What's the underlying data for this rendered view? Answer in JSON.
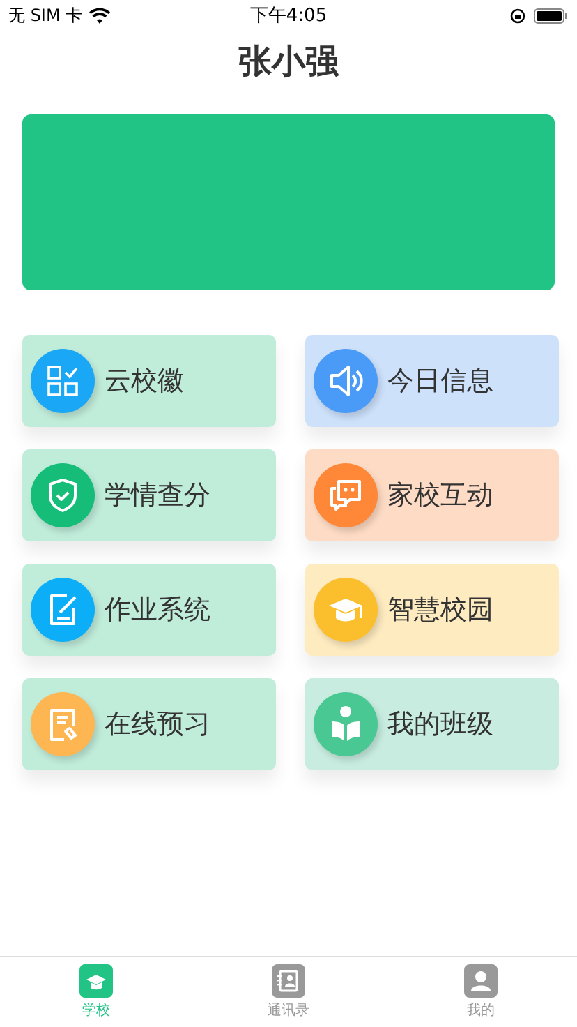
{
  "status_bar": {
    "carrier": "无 SIM 卡",
    "time": "下午4:05"
  },
  "title": "张小强",
  "banner": {
    "color": "#22c486"
  },
  "tiles": [
    {
      "label": "云校徽",
      "kind": "apps",
      "color": "#1aa7f5"
    },
    {
      "label": "今日信息",
      "kind": "speaker",
      "color": "#4a9bf8"
    },
    {
      "label": "学情查分",
      "kind": "shield",
      "color": "#15bd78"
    },
    {
      "label": "家校互动",
      "kind": "chat",
      "color": "#fe8838"
    },
    {
      "label": "作业系统",
      "kind": "edit",
      "color": "#0daef8"
    },
    {
      "label": "智慧校园",
      "kind": "cap",
      "color": "#fbbf2d"
    },
    {
      "label": "在线预习",
      "kind": "note",
      "color": "#fdb651"
    },
    {
      "label": "我的班级",
      "kind": "reader",
      "color": "#4ac893"
    }
  ],
  "tabs": [
    {
      "label": "学校",
      "kind": "school",
      "selected": true
    },
    {
      "label": "通讯录",
      "kind": "contacts",
      "selected": false
    },
    {
      "label": "我的",
      "kind": "profile",
      "selected": false
    }
  ]
}
